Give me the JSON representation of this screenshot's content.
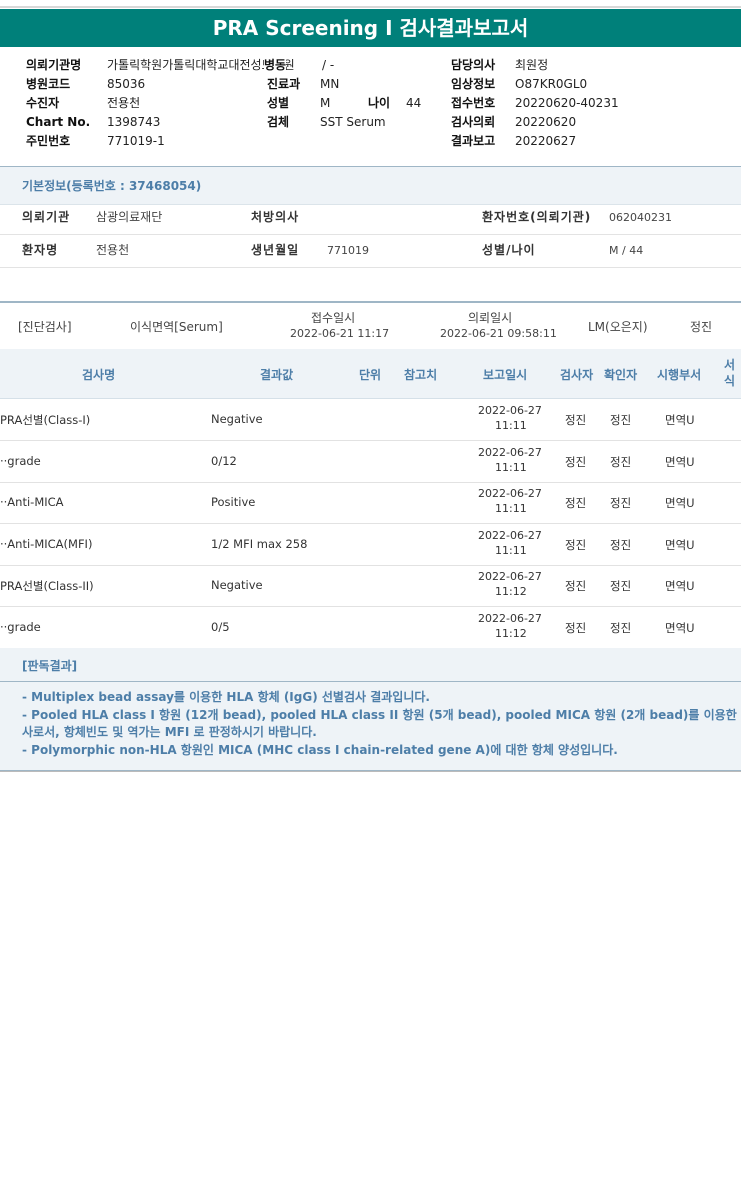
{
  "title": "PRA Screening I 검사결과보고서",
  "header": {
    "rows": [
      {
        "c1_label": "의뢰기관명",
        "c1_value": "가톨릭학원가톨릭대학교대전성모병원",
        "c2_label": "병동",
        "c2_value": "/ -",
        "c3_label": "담당의사",
        "c3_value": "최원정"
      },
      {
        "c1_label": "병원코드",
        "c1_value": "85036",
        "c2_label": "진료과",
        "c2_value": "MN",
        "c3_label": "임상정보",
        "c3_value": "O87KR0GL0"
      },
      {
        "c1_label": "수진자",
        "c1_value": "전용천",
        "c2_label": "성별",
        "c2_value": "M",
        "c2b_label": "나이",
        "c2b_value": "44",
        "c3_label": "접수번호",
        "c3_value": "20220620-40231"
      },
      {
        "c1_label": "Chart No.",
        "c1_value": "1398743",
        "c2_label": "검체",
        "c2_value": "SST Serum",
        "c3_label": "검사의뢰",
        "c3_value": "20220620"
      },
      {
        "c1_label": "주민번호",
        "c1_value": "771019-1",
        "c2_label": "",
        "c2_value": "",
        "c3_label": "결과보고",
        "c3_value": "20220627"
      }
    ]
  },
  "basic_info": {
    "section_title": "기본정보(등록번호 : 37468054)",
    "row1": {
      "l1": "의뢰기관",
      "v1": "삼광의료재단",
      "l2": "처방의사",
      "v2": "",
      "l3": "환자번호(의뢰기관)",
      "v3": "062040231"
    },
    "row2": {
      "l1": "환자명",
      "v1": "전용천",
      "l2": "생년월일",
      "v2": "771019",
      "l3": "성별/나이",
      "v3": "M / 44"
    }
  },
  "diagnosis": {
    "label": "[진단검사]",
    "department": "이식면역[Serum]",
    "received_label": "접수일시",
    "received_value": "2022-06-21  11:17",
    "requested_label": "의뢰일시",
    "requested_value": "2022-06-21  09:58:11",
    "lm": "LM(오은지)",
    "tech": "정진"
  },
  "table": {
    "headers": [
      "검사명",
      "결과값",
      "단위",
      "참고치",
      "보고일시",
      "검사자",
      "확인자",
      "시행부서",
      "서식"
    ],
    "rows": [
      {
        "name": "PRA선별(Class-I)",
        "result": "Negative",
        "date": "2022-06-27",
        "time": "11:11",
        "tester": "정진",
        "checker": "정진",
        "dept": "면역U"
      },
      {
        "name": "··grade",
        "result": "0/12",
        "date": "2022-06-27",
        "time": "11:11",
        "tester": "정진",
        "checker": "정진",
        "dept": "면역U"
      },
      {
        "name": "··Anti-MICA",
        "result": "Positive",
        "date": "2022-06-27",
        "time": "11:11",
        "tester": "정진",
        "checker": "정진",
        "dept": "면역U"
      },
      {
        "name": "··Anti-MICA(MFI)",
        "result": "1/2 MFI max 258",
        "date": "2022-06-27",
        "time": "11:11",
        "tester": "정진",
        "checker": "정진",
        "dept": "면역U"
      },
      {
        "name": "PRA선별(Class-II)",
        "result": "Negative",
        "date": "2022-06-27",
        "time": "11:12",
        "tester": "정진",
        "checker": "정진",
        "dept": "면역U"
      },
      {
        "name": "··grade",
        "result": "0/5",
        "date": "2022-06-27",
        "time": "11:12",
        "tester": "정진",
        "checker": "정진",
        "dept": "면역U"
      }
    ]
  },
  "result_section": {
    "title": "[판독결과]",
    "lines": [
      "- Multiplex bead assay를 이용한 HLA 항체 (IgG) 선별검사 결과입니다.",
      "- Pooled HLA class I 항원 (12개 bead), pooled HLA class II 항원 (5개 bead), pooled MICA 항원 (2개 bead)를 이용한 선별검",
      "사로서, 항체빈도 및 역가는 MFI 로 판정하시기 바랍니다.",
      "- Polymorphic non-HLA 항원인 MICA (MHC class I chain-related gene A)에 대한 항체 양성입니다."
    ]
  }
}
